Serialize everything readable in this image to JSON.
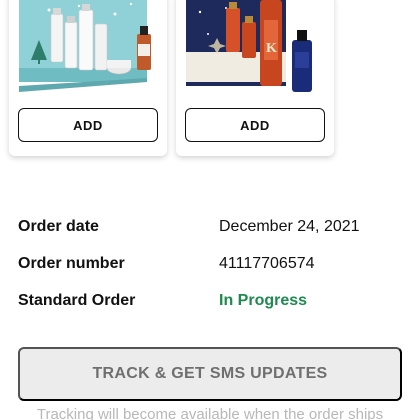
{
  "products": [
    {
      "name": "kiehls-holiday-gift-set",
      "add_label": "ADD"
    },
    {
      "name": "kerastase-gift-set",
      "add_label": "ADD"
    }
  ],
  "order": {
    "date_label": "Order date",
    "date_value": "December 24, 2021",
    "number_label": "Order number",
    "number_value": "41117706574",
    "type_label": "Standard Order",
    "status_value": "In Progress"
  },
  "tracking": {
    "button_label": "TRACK & GET SMS UPDATES",
    "note": "Tracking will become available when the order ships"
  },
  "colors": {
    "status_green": "#1e8a4f",
    "disabled_button_bg": "#ececec",
    "disabled_button_text": "#6f6f6f"
  }
}
